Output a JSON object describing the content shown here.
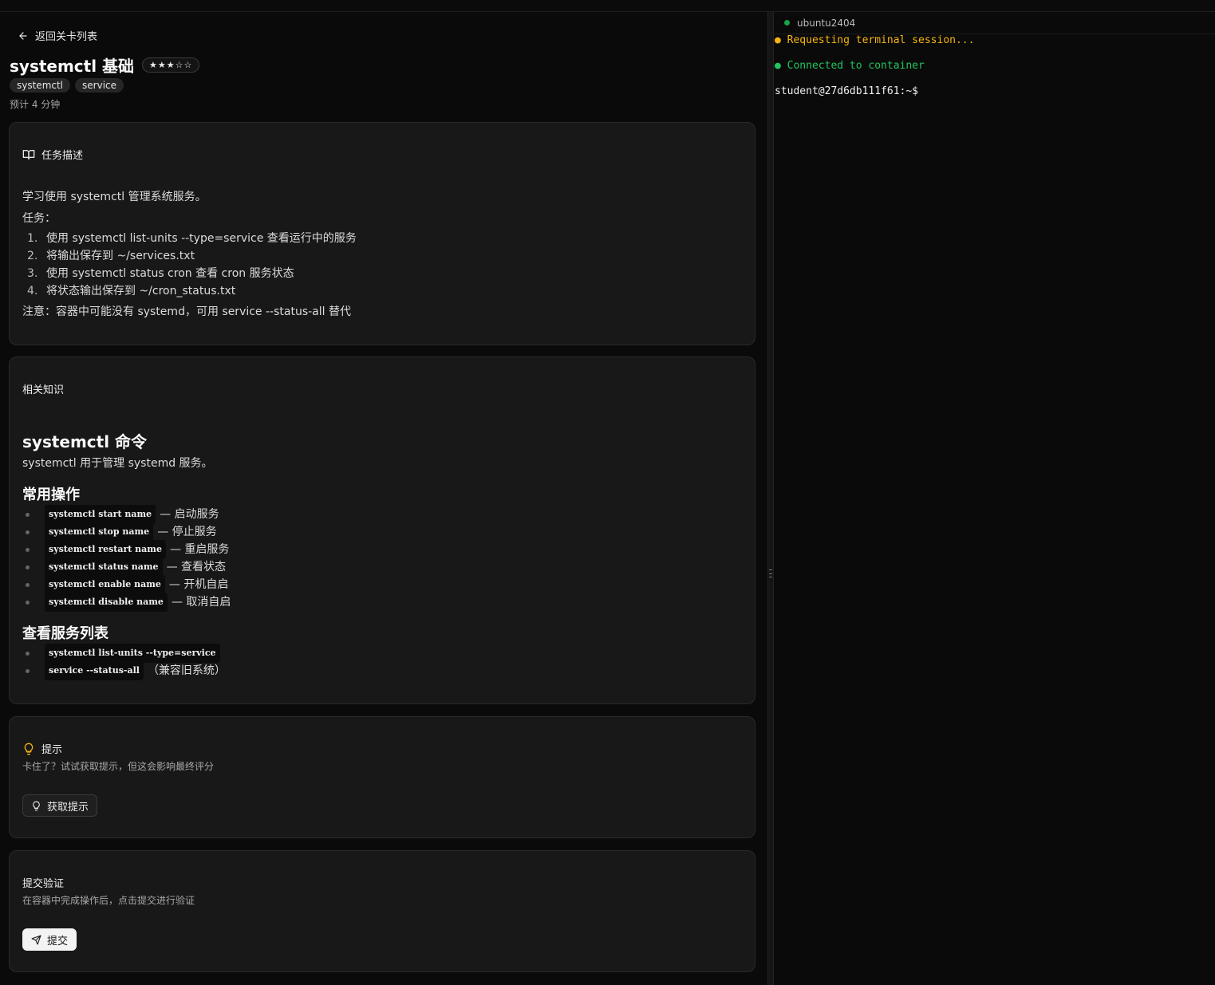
{
  "back_label": "返回关卡列表",
  "level": {
    "title": "systemctl 基础",
    "difficulty": "★★★☆☆",
    "tags": [
      "systemctl",
      "service"
    ],
    "eta": "预计 4 分钟"
  },
  "task": {
    "heading": "任务描述",
    "intro": "学习使用 systemctl 管理系统服务。",
    "tasks_label": "任务：",
    "steps": [
      "使用 systemctl list-units --type=service 查看运行中的服务",
      "将输出保存到 ~/services.txt",
      "使用 systemctl status cron 查看 cron 服务状态",
      "将状态输出保存到 ~/cron_status.txt"
    ],
    "note": "注意：容器中可能没有 systemd，可用 service --status-all 替代"
  },
  "knowledge": {
    "heading": "相关知识",
    "h1": "systemctl 命令",
    "intro": "systemctl 用于管理 systemd 服务。",
    "ops_heading": "常用操作",
    "ops": [
      {
        "code": "systemctl start name",
        "desc": "— 启动服务"
      },
      {
        "code": "systemctl stop name",
        "desc": "— 停止服务"
      },
      {
        "code": "systemctl restart name",
        "desc": "— 重启服务"
      },
      {
        "code": "systemctl status name",
        "desc": "— 查看状态"
      },
      {
        "code": "systemctl enable name",
        "desc": "— 开机自启"
      },
      {
        "code": "systemctl disable name",
        "desc": "— 取消自启"
      }
    ],
    "list_heading": "查看服务列表",
    "list": [
      {
        "code": "systemctl list-units --type=service",
        "desc": ""
      },
      {
        "code": "service --status-all",
        "desc": "（兼容旧系统）"
      }
    ]
  },
  "hint": {
    "heading": "提示",
    "sub": "卡住了？试试获取提示，但这会影响最终评分",
    "button": "获取提示"
  },
  "submit": {
    "heading": "提交验证",
    "sub": "在容器中完成操作后，点击提交进行验证",
    "button": "提交"
  },
  "terminal": {
    "host": "ubuntu2404",
    "line1": "● Requesting terminal session...",
    "line2": "● Connected to container",
    "prompt": "student@27d6db111f61:~$"
  },
  "colors": {
    "accent_yellow": "#f5b40f",
    "accent_green": "#22c55e",
    "status_dot": "#16a34a"
  }
}
